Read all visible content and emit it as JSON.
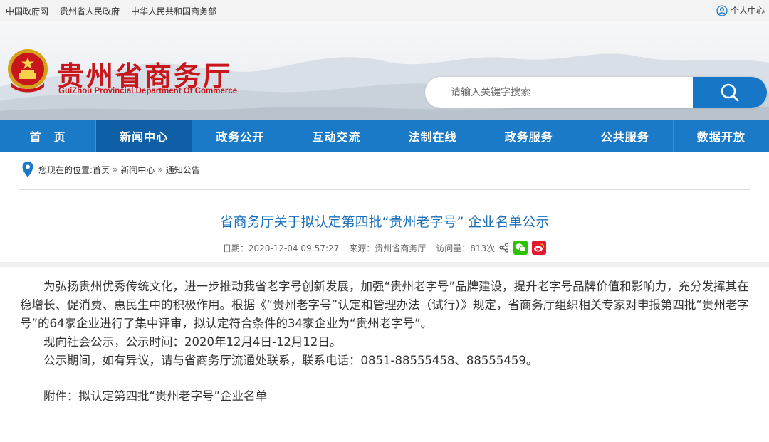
{
  "topbar": {
    "links": [
      "中国政府网",
      "贵州省人民政府",
      "中华人民共和国商务部"
    ],
    "user_label": "个人中心"
  },
  "header": {
    "title": "贵州省商务厅",
    "subtitle": "GuiZhou Provincial Department Of Commerce"
  },
  "search": {
    "placeholder": "请输入关键字搜索"
  },
  "nav": {
    "items": [
      {
        "label": "首　页"
      },
      {
        "label": "新闻中心"
      },
      {
        "label": "政务公开"
      },
      {
        "label": "互动交流"
      },
      {
        "label": "法制在线"
      },
      {
        "label": "政务服务"
      },
      {
        "label": "公共服务"
      },
      {
        "label": "数据开放"
      }
    ],
    "active_index": 1
  },
  "breadcrumb": {
    "prefix": "您现在的位置:",
    "items": [
      "首页",
      "新闻中心",
      "通知公告"
    ],
    "separator": "»"
  },
  "article": {
    "title": "省商务厅关于拟认定第四批“贵州老字号” 企业名单公示",
    "date": "日期：2020-12-04 09:57:27",
    "source": "来源：贵州省商务厅",
    "views": "访问量：813次",
    "paragraphs": [
      "为弘扬贵州优秀传统文化，进一步推动我省老字号创新发展，加强“贵州老字号”品牌建设，提升老字号品牌价值和影响力，充分发挥其在稳增长、促消费、惠民生中的积极作用。根据《“贵州老字号”认定和管理办法（试行）》规定，省商务厅组织相关专家对申报第四批“贵州老字号”的64家企业进行了集中评审，拟认定符合条件的34家企业为“贵州老字号”。",
      "现向社会公示，公示时间：2020年12月4日-12月12日。",
      "公示期间，如有异议，请与省商务厅流通处联系，联系电话：0851-88555458、88555459。",
      "附件：拟认定第四批“贵州老字号”企业名单"
    ]
  },
  "colors": {
    "nav_blue": "#1a7ac8",
    "nav_active": "#0f5fa7",
    "title_red": "#c8171c",
    "article_title": "#1a6fba",
    "wechat_green": "#2dc100",
    "weibo_red": "#e6162d"
  },
  "icons": {
    "user": "user-circle-icon",
    "search": "search-icon",
    "location": "map-pin-icon",
    "share": "share-icon",
    "wechat": "wechat-icon",
    "weibo": "weibo-icon",
    "emblem": "national-emblem-icon"
  }
}
